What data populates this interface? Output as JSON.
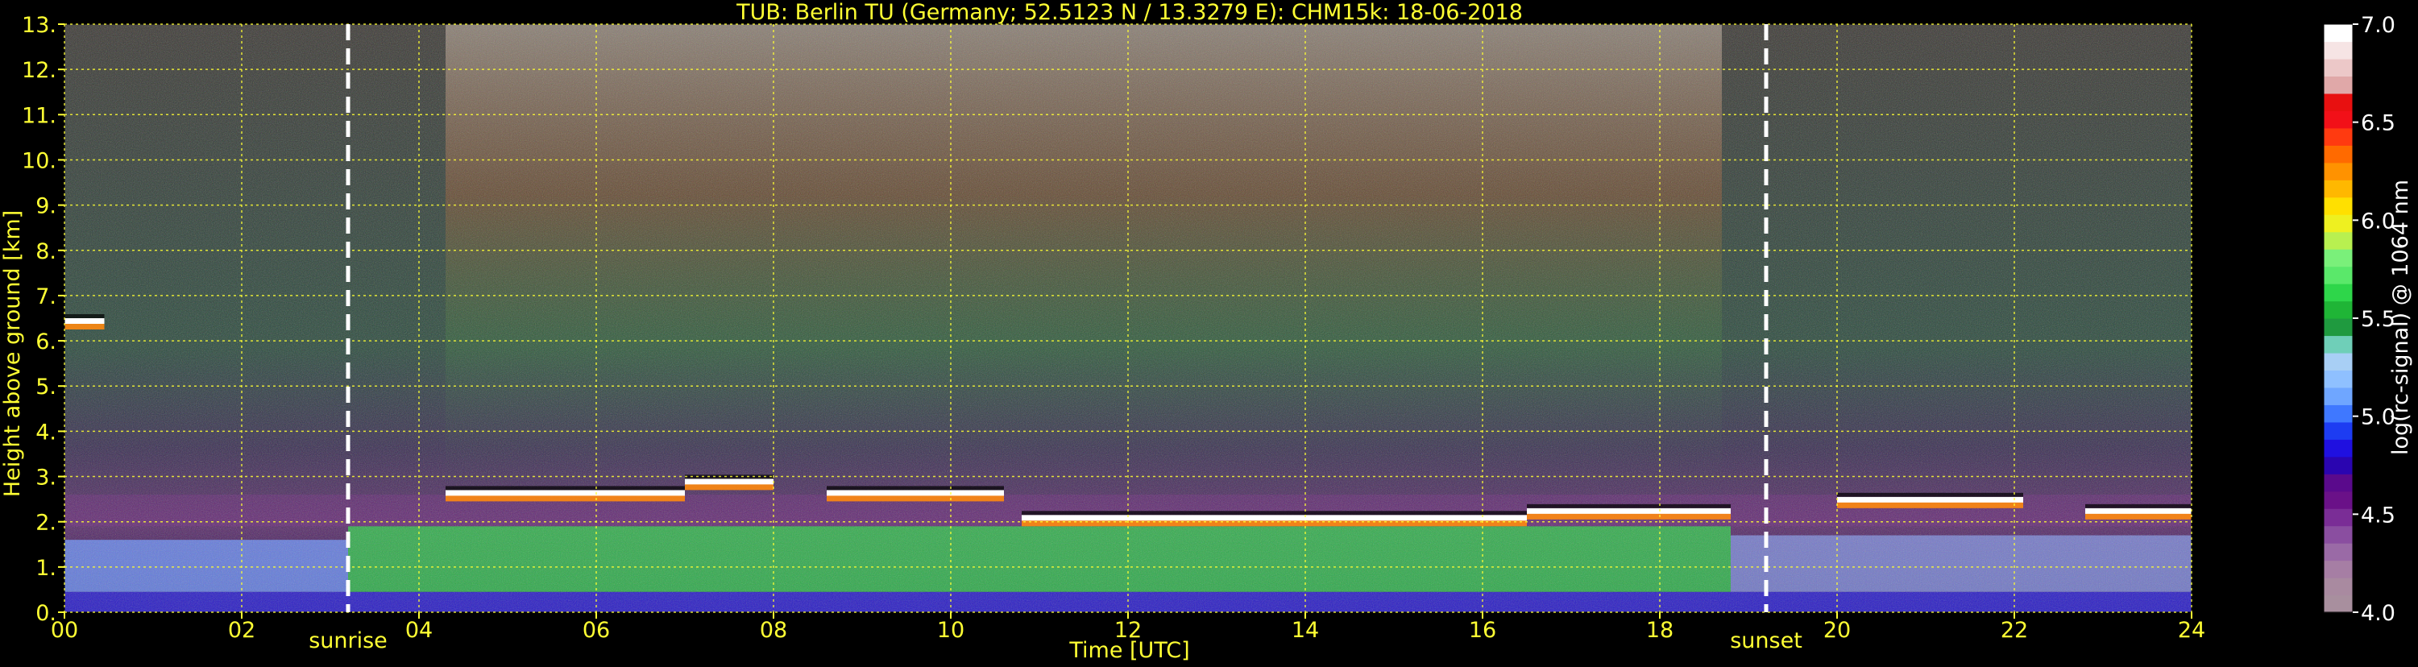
{
  "colors": {
    "background": "#000000",
    "label": "#ffff33",
    "grid": "#ffff33",
    "marker_line": "#ffffff",
    "colorbar_label": "#ffffff"
  },
  "chart_data": {
    "type": "heatmap",
    "title": "TUB: Berlin TU (Germany; 52.5123 N / 13.3279 E):    CHM15k: 18-06-2018",
    "xlabel": "Time [UTC]",
    "ylabel": "Height above ground [km]",
    "xlim": [
      0,
      24
    ],
    "ylim": [
      0,
      13
    ],
    "x_tick_labels": [
      "00",
      "02",
      "04",
      "06",
      "08",
      "10",
      "12",
      "14",
      "16",
      "18",
      "20",
      "22",
      "24"
    ],
    "x_tick_values": [
      0,
      2,
      4,
      6,
      8,
      10,
      12,
      14,
      16,
      18,
      20,
      22,
      24
    ],
    "y_tick_labels": [
      "0.",
      "1.",
      "2.",
      "3.",
      "4.",
      "5.",
      "6.",
      "7.",
      "8.",
      "9.",
      "10.",
      "11.",
      "12.",
      "13."
    ],
    "y_tick_values": [
      0,
      1,
      2,
      3,
      4,
      5,
      6,
      7,
      8,
      9,
      10,
      11,
      12,
      13
    ],
    "grid": true,
    "events": [
      {
        "label": "sunrise",
        "time": 3.2
      },
      {
        "label": "sunset",
        "time": 19.2
      }
    ],
    "colorbar": {
      "label": "log(rc-signal) @ 1064 nm",
      "range": [
        4.0,
        7.0
      ],
      "tick_labels": [
        "4.0",
        "4.5",
        "5.0",
        "5.5",
        "6.0",
        "6.5",
        "7.0"
      ],
      "tick_values": [
        4.0,
        4.5,
        5.0,
        5.5,
        6.0,
        6.5,
        7.0
      ],
      "colors": [
        "#a88f9e",
        "#a98aa0",
        "#a67ea4",
        "#9a6aa6",
        "#8a4ea0",
        "#7a2d96",
        "#6a1188",
        "#5a0a8c",
        "#2a05b0",
        "#1f10e0",
        "#1d3cf2",
        "#3f78ff",
        "#6fa6ff",
        "#8fc0ff",
        "#a8cff5",
        "#6fcfb8",
        "#1f9a3f",
        "#1fb536",
        "#2ed64a",
        "#5ae86a",
        "#7af07a",
        "#b8f050",
        "#eef020",
        "#ffe000",
        "#ffb800",
        "#ff9200",
        "#ff6a00",
        "#ff3a10",
        "#f21018",
        "#e81010",
        "#e0a8a8",
        "#ecc8c8",
        "#f6e4e4",
        "#ffffff"
      ]
    },
    "cloud_top_layers": [
      {
        "x": [
          0.0,
          0.45
        ],
        "height": 6.5
      },
      {
        "x": [
          4.3,
          7.0
        ],
        "height": 2.7
      },
      {
        "x": [
          7.0,
          8.0
        ],
        "height": 2.95
      },
      {
        "x": [
          8.6,
          10.6
        ],
        "height": 2.7
      },
      {
        "x": [
          10.8,
          16.5
        ],
        "height": 2.15
      },
      {
        "x": [
          16.5,
          18.8
        ],
        "height": 2.3
      },
      {
        "x": [
          20.0,
          22.1
        ],
        "height": 2.55
      },
      {
        "x": [
          22.8,
          24.0
        ],
        "height": 2.3
      }
    ],
    "aerosol_layers": [
      {
        "x": [
          0,
          24
        ],
        "bottom": 0.0,
        "top": 0.45,
        "value": 5.0
      },
      {
        "x": [
          0,
          3.2
        ],
        "bottom": 0.45,
        "top": 1.6,
        "value": 5.4
      },
      {
        "x": [
          3.2,
          18.8
        ],
        "bottom": 0.45,
        "top": 1.9,
        "value": 5.6
      },
      {
        "x": [
          18.8,
          24
        ],
        "bottom": 0.45,
        "top": 1.7,
        "value": 5.3
      }
    ]
  }
}
